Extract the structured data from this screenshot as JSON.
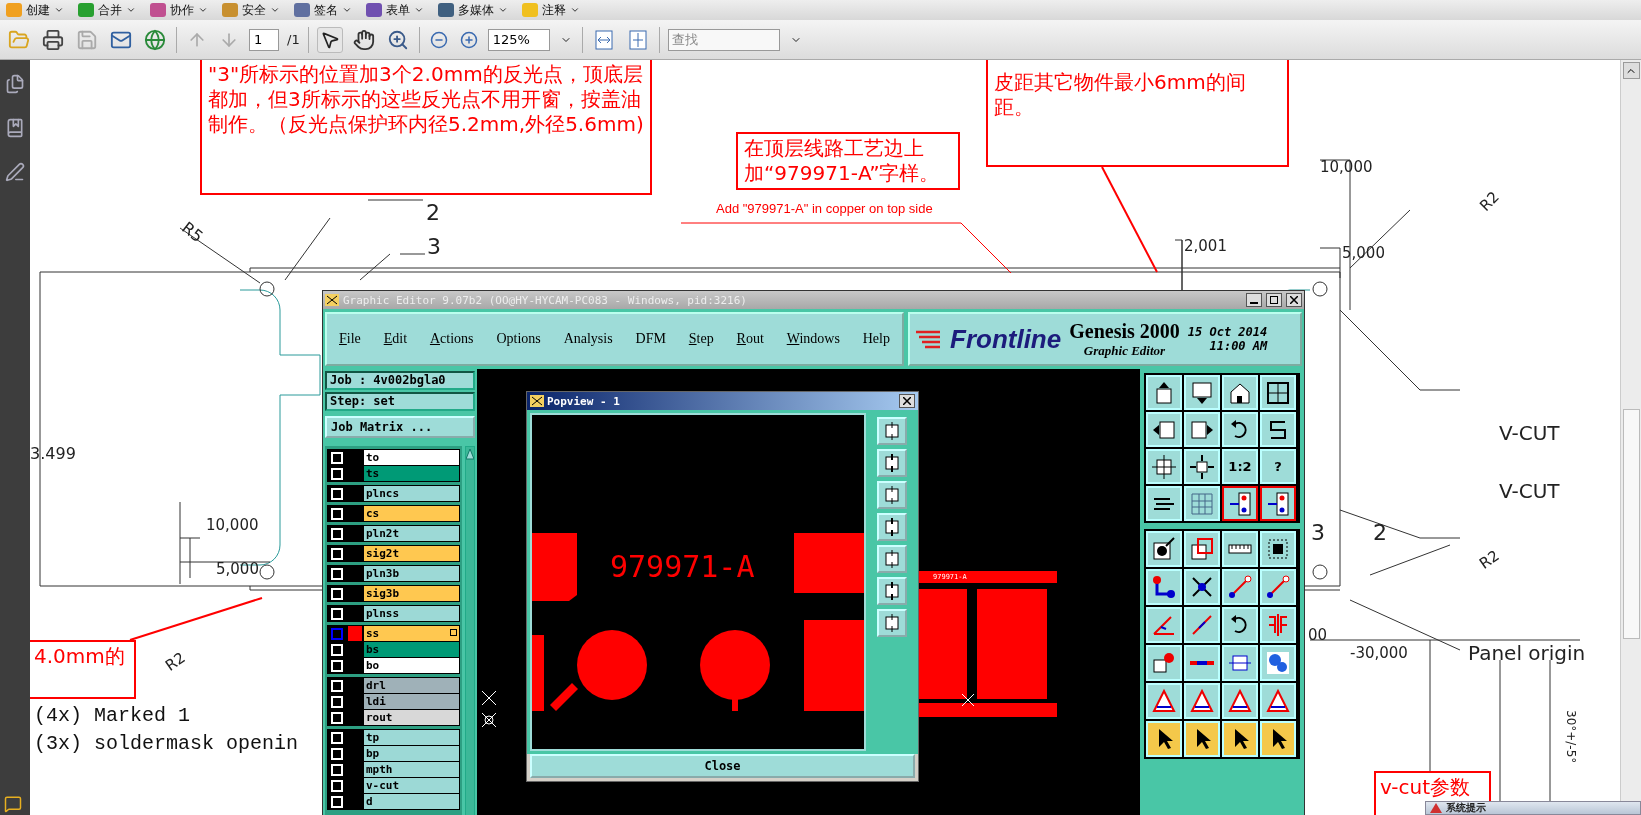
{
  "menu": [
    {
      "label": "创建"
    },
    {
      "label": "合并"
    },
    {
      "label": "协作"
    },
    {
      "label": "安全"
    },
    {
      "label": "签名"
    },
    {
      "label": "表单"
    },
    {
      "label": "多媒体"
    },
    {
      "label": "注释"
    }
  ],
  "toolbar": {
    "page": "1",
    "page_count": "/1",
    "zoom": "125%",
    "search_placeholder": "查找"
  },
  "notes": {
    "reflector": "\"3\"所标示的位置加3个2.0mm的反光点，顶底层都加，但3所标示的这些反光点不用开窗，按盖油制作。（反光点保护环内径5.2mm,外径5.6mm)",
    "marking": "在顶层线路工艺边上加“979971-A”字样。",
    "marking_en": "Add \"979971-A\" in copper on top side",
    "spacing": "皮距其它物件最小6mm的间距。",
    "hole": "4.0mm的",
    "vcut": "v-cut参数"
  },
  "drawing_labels": [
    "2",
    "3",
    "R5",
    "3.499",
    "10,000",
    "5,000",
    "R2",
    "10,000",
    "5,000",
    "2,001",
    "R2",
    "V-CUT",
    "V-CUT",
    "R2",
    "3",
    "2",
    "00",
    "-30,000",
    "Panel origin",
    "30°+/-5°"
  ],
  "legend_lines": [
    "(4x) Marked 1",
    "(3x) soldermask openin"
  ],
  "genesis": {
    "title": "Graphic Editor 9.07b2 (OO@HY-HYCAM-PC083 - Windows, pid:3216)",
    "menu": [
      {
        "label": "File",
        "underlined": true
      },
      {
        "label": "Edit",
        "underlined": true
      },
      {
        "label": "Actions",
        "underlined": true
      },
      {
        "label": "Options",
        "underlined": false
      },
      {
        "label": "Analysis",
        "underlined": false
      },
      {
        "label": "DFM",
        "underlined": false
      },
      {
        "label": "Step",
        "underlined": true
      },
      {
        "label": "Rout",
        "underlined": true
      },
      {
        "label": "Windows",
        "underlined": true
      },
      {
        "label": "Help",
        "underlined": false
      }
    ],
    "logo": "Frontline",
    "product": "Genesis 2000",
    "subtitle": "Graphic Editor",
    "date": "15 Oct 2014",
    "time": "11:00 AM",
    "job": "Job : 4v002bgla0",
    "step": "Step: set",
    "matrix_button": "Job Matrix ...",
    "layer_groups": [
      {
        "layers": [
          {
            "name": "to",
            "color": "#ffffff",
            "selected": false
          },
          {
            "name": "ts",
            "color": "#009a76",
            "selected": false
          }
        ]
      },
      {
        "layers": [
          {
            "name": "plncs",
            "color": "#9cd9d6",
            "selected": false
          }
        ]
      },
      {
        "layers": [
          {
            "name": "cs",
            "color": "#ffc850",
            "selected": false
          }
        ]
      },
      {
        "layers": [
          {
            "name": "pln2t",
            "color": "#9cd9d6",
            "selected": false
          }
        ]
      },
      {
        "layers": [
          {
            "name": "sig2t",
            "color": "#ffc850",
            "selected": false
          }
        ]
      },
      {
        "layers": [
          {
            "name": "pln3b",
            "color": "#9cd9d6",
            "selected": false
          }
        ]
      },
      {
        "layers": [
          {
            "name": "sig3b",
            "color": "#ffc850",
            "selected": false
          }
        ]
      },
      {
        "layers": [
          {
            "name": "plnss",
            "color": "#9cd9d6",
            "selected": false
          }
        ]
      },
      {
        "layers": [
          {
            "name": "ss",
            "color": "#ffc850",
            "selected": true
          },
          {
            "name": "bs",
            "color": "#009a76",
            "selected": false
          },
          {
            "name": "bo",
            "color": "#ffffff",
            "selected": false
          }
        ]
      },
      {
        "layers": [
          {
            "name": "drl",
            "color": "#9fb1b8",
            "selected": false
          },
          {
            "name": "ldi",
            "color": "#9fb1b8",
            "selected": false
          },
          {
            "name": "rout",
            "color": "#d8d8d8",
            "selected": false
          }
        ]
      },
      {
        "layers": [
          {
            "name": "tp",
            "color": "#9cd9d6",
            "selected": false
          },
          {
            "name": "bp",
            "color": "#9cd9d6",
            "selected": false
          },
          {
            "name": "mpth",
            "color": "#9cd9d6",
            "selected": false
          },
          {
            "name": "v-cut",
            "color": "#9cd9d6",
            "selected": false
          },
          {
            "name": "d",
            "color": "#9cd9d6",
            "selected": false
          }
        ]
      }
    ],
    "popview": {
      "title": "Popview - 1",
      "view_text": "979971-A",
      "close": "Close"
    },
    "board_text": "979971-A",
    "tools_top": [
      {
        "kind": "up",
        "active": false
      },
      {
        "kind": "down",
        "active": false
      },
      {
        "kind": "house",
        "active": false
      },
      {
        "kind": "frame",
        "active": false
      },
      {
        "kind": "left",
        "active": false
      },
      {
        "kind": "right",
        "active": false
      },
      {
        "kind": "undo",
        "active": false
      },
      {
        "kind": "wave",
        "active": false
      },
      {
        "kind": "fit",
        "active": false
      },
      {
        "kind": "center",
        "active": false
      },
      {
        "kind": "text",
        "label": "1:2",
        "active": false
      },
      {
        "kind": "text",
        "label": "?",
        "active": false
      },
      {
        "kind": "layers",
        "active": false
      },
      {
        "kind": "mesh",
        "active": false
      },
      {
        "kind": "circuit",
        "active": true
      },
      {
        "kind": "circuit",
        "active": true
      }
    ],
    "tools_bottom": [
      {
        "kind": "snap",
        "active": false
      },
      {
        "kind": "window",
        "active": false
      },
      {
        "kind": "ruler",
        "active": false
      },
      {
        "kind": "dots",
        "active": false
      },
      {
        "kind": "network",
        "active": false
      },
      {
        "kind": "cross",
        "active": false
      },
      {
        "kind": "link",
        "active": false
      },
      {
        "kind": "link",
        "active": false
      },
      {
        "kind": "angle",
        "active": false
      },
      {
        "kind": "diag",
        "active": false
      },
      {
        "kind": "undo",
        "active": false
      },
      {
        "kind": "mirror",
        "active": false
      },
      {
        "kind": "pad",
        "active": false
      },
      {
        "kind": "bar",
        "active": false
      },
      {
        "kind": "bracket",
        "active": false
      },
      {
        "kind": "circles",
        "active": false
      },
      {
        "kind": "triangle",
        "active": false
      },
      {
        "kind": "triangle",
        "active": false
      },
      {
        "kind": "triangle",
        "active": false
      },
      {
        "kind": "triangle",
        "active": false
      },
      {
        "kind": "pointer",
        "active": false
      },
      {
        "kind": "pointer",
        "active": false
      },
      {
        "kind": "pointer",
        "active": false
      },
      {
        "kind": "pointer",
        "active": false
      }
    ]
  },
  "notice": {
    "title": "系统提示"
  }
}
